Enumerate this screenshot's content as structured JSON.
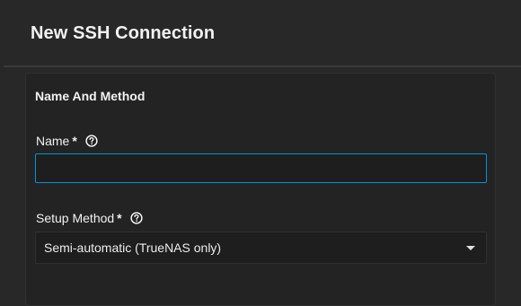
{
  "header": {
    "title": "New SSH Connection"
  },
  "section": {
    "title": "Name And Method"
  },
  "fields": {
    "name": {
      "label": "Name",
      "required_marker": "*",
      "value": "",
      "help_icon": "help-circle-icon"
    },
    "setup_method": {
      "label": "Setup Method",
      "required_marker": "*",
      "selected": "Semi-automatic (TrueNAS only)",
      "help_icon": "help-circle-icon",
      "dropdown_icon": "caret-down-icon"
    }
  },
  "colors": {
    "background": "#282828",
    "card_background": "#232323",
    "input_background": "#1e1e1e",
    "focus_border": "#0095d5",
    "text": "#f2f2f2"
  }
}
